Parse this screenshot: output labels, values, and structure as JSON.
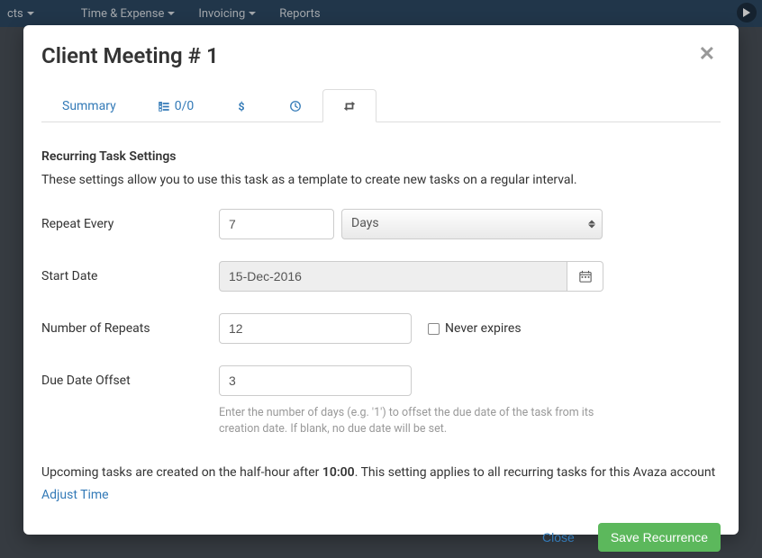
{
  "topbar": {
    "nav": [
      "cts",
      "Time & Expense",
      "Invoicing",
      "Reports"
    ]
  },
  "modal": {
    "title": "Client Meeting # 1",
    "tabs": {
      "summary": "Summary",
      "checklist": "0/0"
    },
    "section": {
      "title": "Recurring Task Settings",
      "desc": "These settings allow you to use this task as a template to create new tasks on a regular interval."
    },
    "form": {
      "repeat_every_label": "Repeat Every",
      "repeat_every_value": "7",
      "repeat_unit": "Days",
      "start_date_label": "Start Date",
      "start_date_value": "15-Dec-2016",
      "num_repeats_label": "Number of Repeats",
      "num_repeats_value": "12",
      "never_expires_label": "Never expires",
      "due_offset_label": "Due Date Offset",
      "due_offset_value": "3",
      "due_offset_help": "Enter the number of days (e.g. '1') to offset the due date of the task from its creation date. If blank, no due date will be set."
    },
    "info": {
      "prefix": "Upcoming tasks are created on the half-hour after ",
      "time": "10:00",
      "suffix": ". This setting applies to all recurring tasks for this Avaza account",
      "adjust_link": "Adjust Time"
    },
    "footer": {
      "close": "Close",
      "save": "Save Recurrence"
    }
  }
}
